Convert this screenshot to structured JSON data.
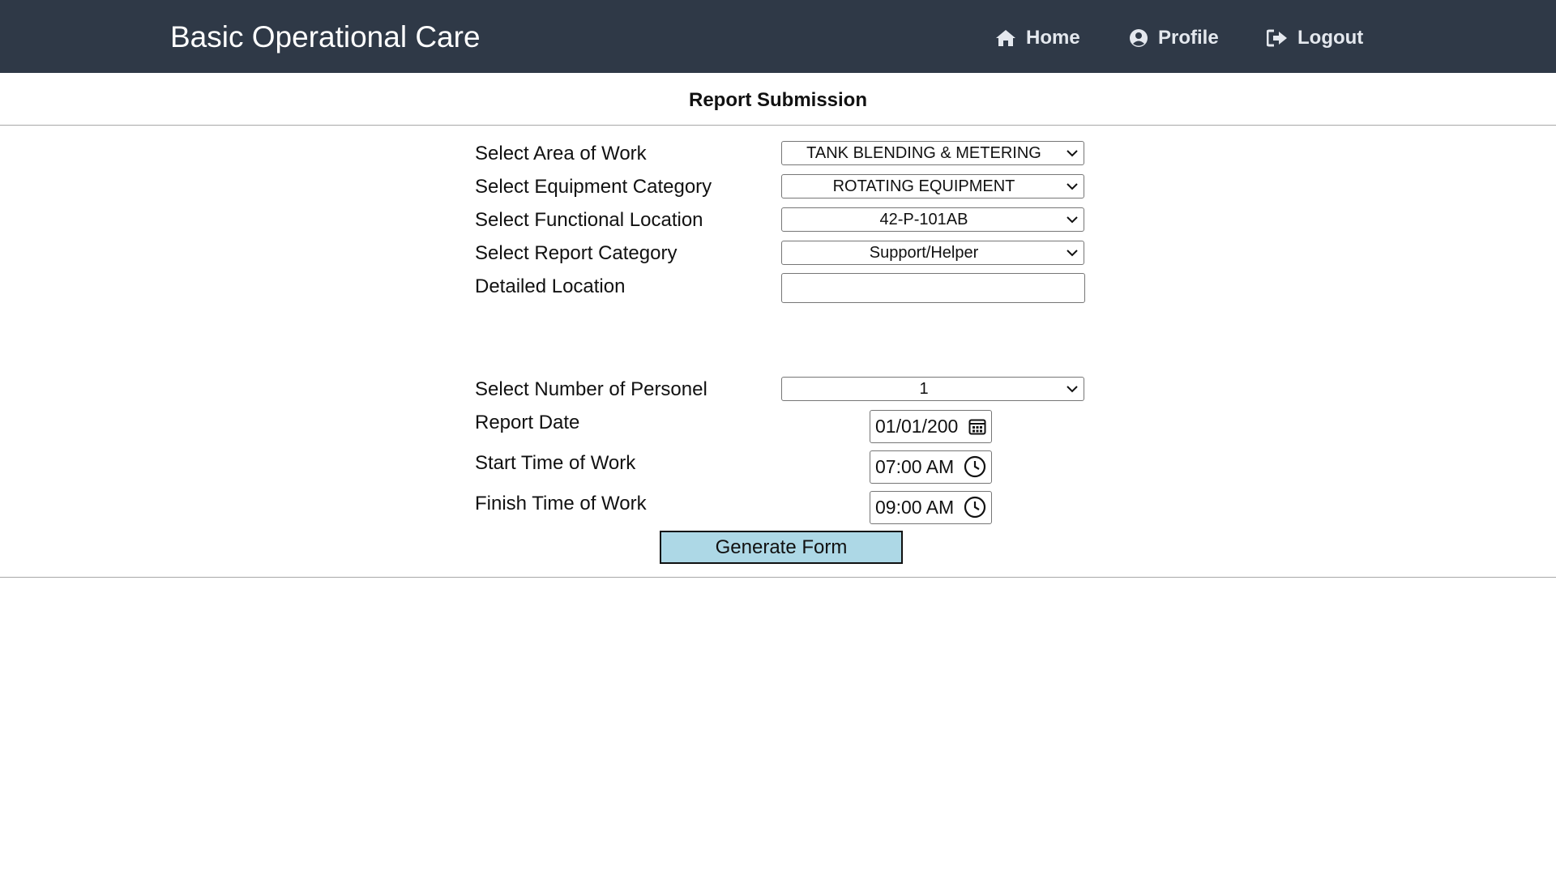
{
  "header": {
    "brand": "Basic Operational Care",
    "nav": [
      {
        "label": "Home",
        "icon": "home-icon"
      },
      {
        "label": "Profile",
        "icon": "user-circle-icon"
      },
      {
        "label": "Logout",
        "icon": "sign-out-icon"
      }
    ],
    "background_color": "#2f3947"
  },
  "page": {
    "title": "Report Submission"
  },
  "form": {
    "area_of_work": {
      "label": "Select Area of Work",
      "value": "TANK BLENDING & METERING"
    },
    "equipment_category": {
      "label": "Select Equipment Category",
      "value": "ROTATING EQUIPMENT"
    },
    "functional_location": {
      "label": "Select Functional Location",
      "value": "42-P-101AB"
    },
    "report_category": {
      "label": "Select Report Category",
      "value": "Support/Helper"
    },
    "detailed_location": {
      "label": "Detailed Location",
      "value": ""
    },
    "number_of_personnel": {
      "label": "Select Number of Personel",
      "value": "1"
    },
    "report_date": {
      "label": "Report Date",
      "value": "01/01/200"
    },
    "start_time": {
      "label": "Start Time of Work",
      "value": "07:00 AM"
    },
    "finish_time": {
      "label": "Finish Time of Work",
      "value": "09:00 AM"
    },
    "submit_label": "Generate Form",
    "submit_color": "#add8e6"
  }
}
